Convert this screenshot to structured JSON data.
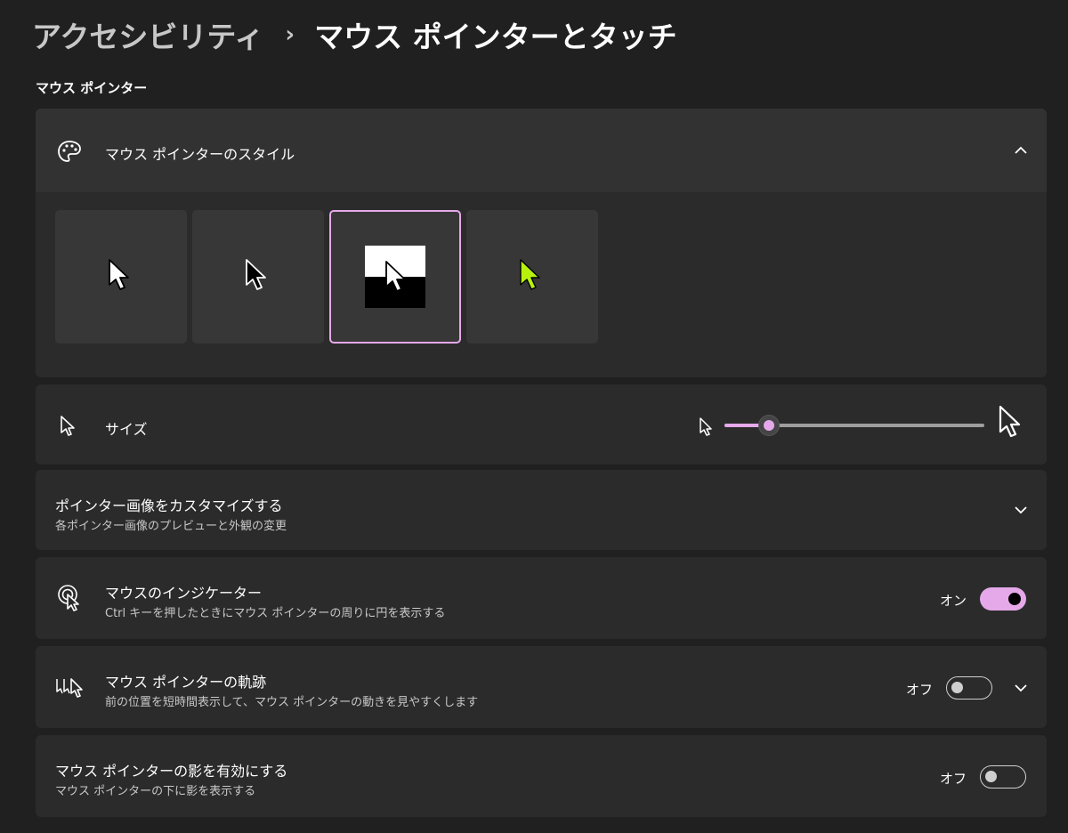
{
  "breadcrumb": {
    "parent": "アクセシビリティ",
    "separator": "›",
    "current": "マウス ポインターとタッチ"
  },
  "section": {
    "title": "マウス ポインター"
  },
  "pointer_style": {
    "label": "マウス ポインターのスタイル",
    "icon": "palette-icon",
    "expanded": true,
    "options": [
      {
        "name": "white",
        "selected": false
      },
      {
        "name": "black",
        "selected": false
      },
      {
        "name": "inverted",
        "selected": true
      },
      {
        "name": "custom",
        "selected": false,
        "color": "#b7f20c"
      }
    ]
  },
  "size": {
    "label": "サイズ",
    "icon": "pointer-icon",
    "value_fraction": 0.17
  },
  "customize": {
    "label": "ポインター画像をカスタマイズする",
    "sub": "各ポインター画像のプレビューと外観の変更"
  },
  "indicator": {
    "label": "マウスのインジケーター",
    "sub": "Ctrl キーを押したときにマウス ポインターの周りに円を表示する",
    "state_text": "オン",
    "on": true
  },
  "trail": {
    "label": "マウス ポインターの軌跡",
    "sub": "前の位置を短時間表示して、マウス ポインターの動きを見やすくします",
    "state_text": "オフ",
    "on": false
  },
  "shadow": {
    "label": "マウス ポインターの影を有効にする",
    "sub": "マウス ポインターの下に影を表示する",
    "state_text": "オフ",
    "on": false
  },
  "colors": {
    "accent": "#e5a9ea",
    "background": "#202020",
    "card": "#2b2b2b"
  }
}
